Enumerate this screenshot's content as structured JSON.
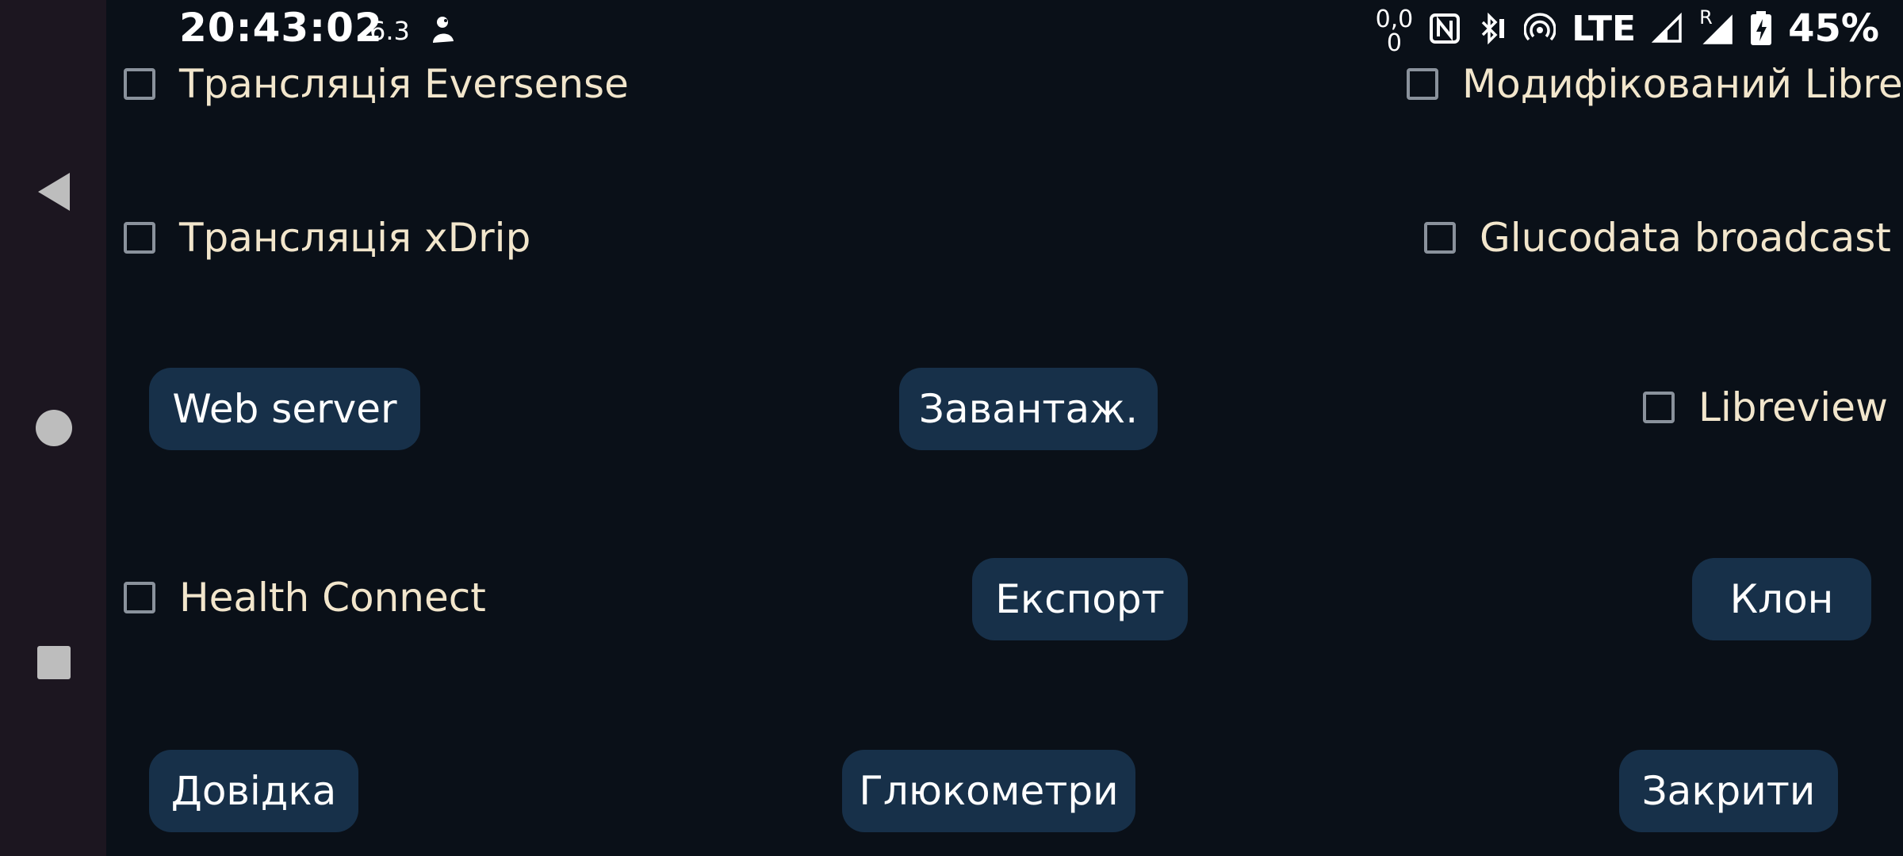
{
  "status_bar": {
    "time": "20:43:02",
    "small_text": "6.3",
    "net_speed_top": "0,0",
    "net_speed_bottom": "0",
    "network_type": "LTE",
    "roaming_label": "R",
    "battery_percent": "45%"
  },
  "checkboxes": {
    "eversense": {
      "label": "Трансляція Eversense",
      "checked": false
    },
    "modified_libre": {
      "label": "Модифікований Libre",
      "checked": false
    },
    "xdrip": {
      "label": "Трансляція xDrip",
      "checked": false
    },
    "glucodata": {
      "label": "Glucodata broadcast",
      "checked": false
    },
    "libreview": {
      "label": "Libreview",
      "checked": false
    },
    "health_connect": {
      "label": "Health Connect",
      "checked": false
    }
  },
  "buttons": {
    "web_server": "Web server",
    "download": "Завантаж.",
    "export": "Експорт",
    "clone": "Клон",
    "help": "Довідка",
    "glucometers": "Глюкометри",
    "close": "Закрити"
  },
  "colors": {
    "background": "#0a1018",
    "button_bg": "#173049",
    "checkbox_label": "#f2e6cc",
    "navbar_bg": "#1c1620"
  }
}
